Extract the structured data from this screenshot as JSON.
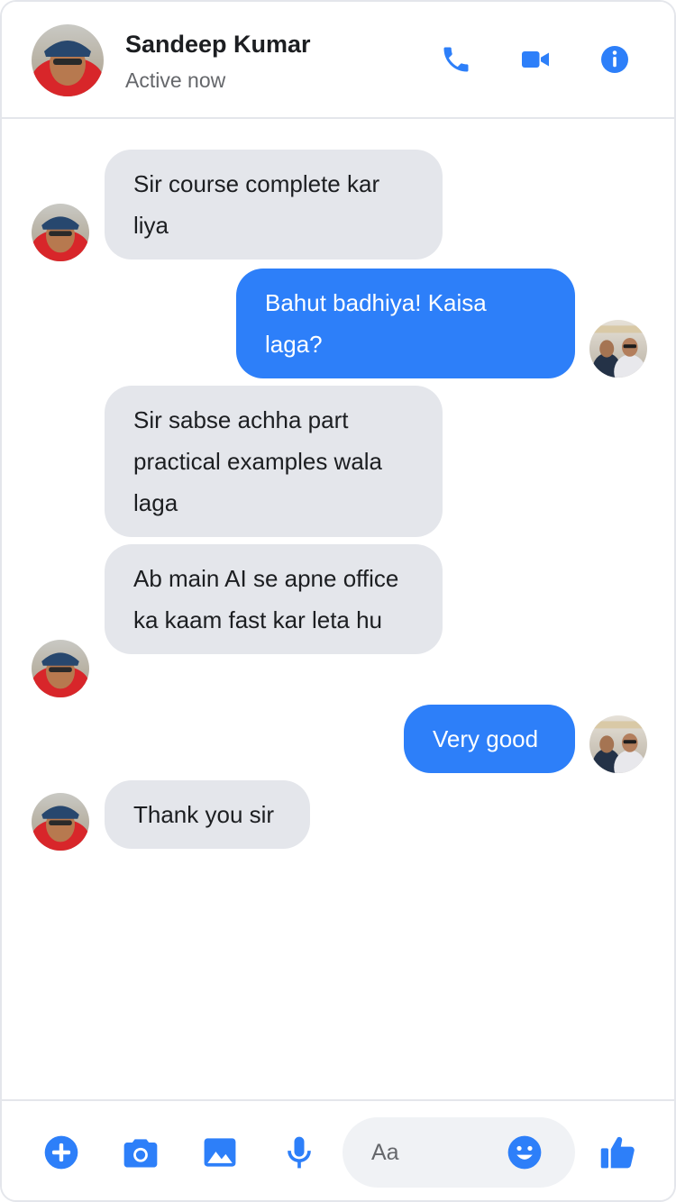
{
  "colors": {
    "accent": "#2d7ff9",
    "incoming_bubble": "#e4e6eb",
    "outgoing_bubble": "#2d7ff9",
    "outgoing_text": "#ffffff",
    "secondary_text": "#65676b",
    "input_bg": "#f0f2f5"
  },
  "header": {
    "contact_name": "Sandeep Kumar",
    "status": "Active now",
    "actions": [
      {
        "icon": "phone-icon"
      },
      {
        "icon": "video-camera-icon"
      },
      {
        "icon": "info-icon"
      }
    ]
  },
  "messages": [
    {
      "direction": "incoming",
      "text": "Sir course complete kar liya"
    },
    {
      "direction": "outgoing",
      "text": "Bahut badhiya! Kaisa laga?"
    },
    {
      "direction": "incoming",
      "text": "Sir sabse achha part practical examples wala laga"
    },
    {
      "direction": "incoming",
      "text": "Ab main AI se apne office ka kaam fast kar leta hu"
    },
    {
      "direction": "outgoing",
      "text": "Very good"
    },
    {
      "direction": "incoming",
      "text": "Thank you sir"
    }
  ],
  "composer": {
    "placeholder": "Aa",
    "actions": [
      {
        "icon": "plus-circle-icon"
      },
      {
        "icon": "camera-icon"
      },
      {
        "icon": "image-icon"
      },
      {
        "icon": "microphone-icon"
      }
    ],
    "emoji_icon": "smile-emoji-icon",
    "like_icon": "thumbs-up-icon"
  }
}
